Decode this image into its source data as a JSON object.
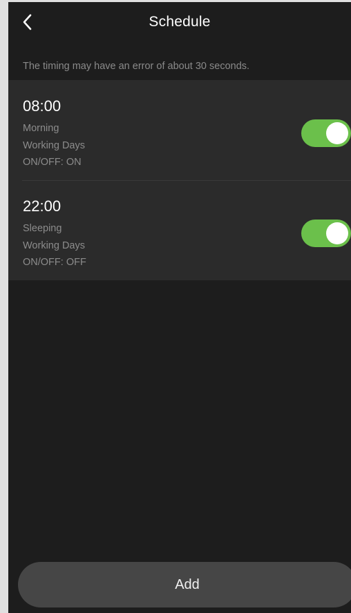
{
  "header": {
    "title": "Schedule",
    "back_icon": "chevron-left-icon"
  },
  "notice": "The timing may have an error of about 30 seconds.",
  "schedules": [
    {
      "time": "08:00",
      "name": "Morning",
      "repeat": "Working Days",
      "action": "ON/OFF: ON",
      "enabled": true
    },
    {
      "time": "22:00",
      "name": "Sleeping",
      "repeat": "Working Days",
      "action": "ON/OFF: OFF",
      "enabled": true
    }
  ],
  "footer": {
    "add_label": "Add"
  },
  "colors": {
    "background": "#1d1d1d",
    "card": "#2b2b2b",
    "toggle_on": "#6bc04b",
    "button": "#464646"
  }
}
